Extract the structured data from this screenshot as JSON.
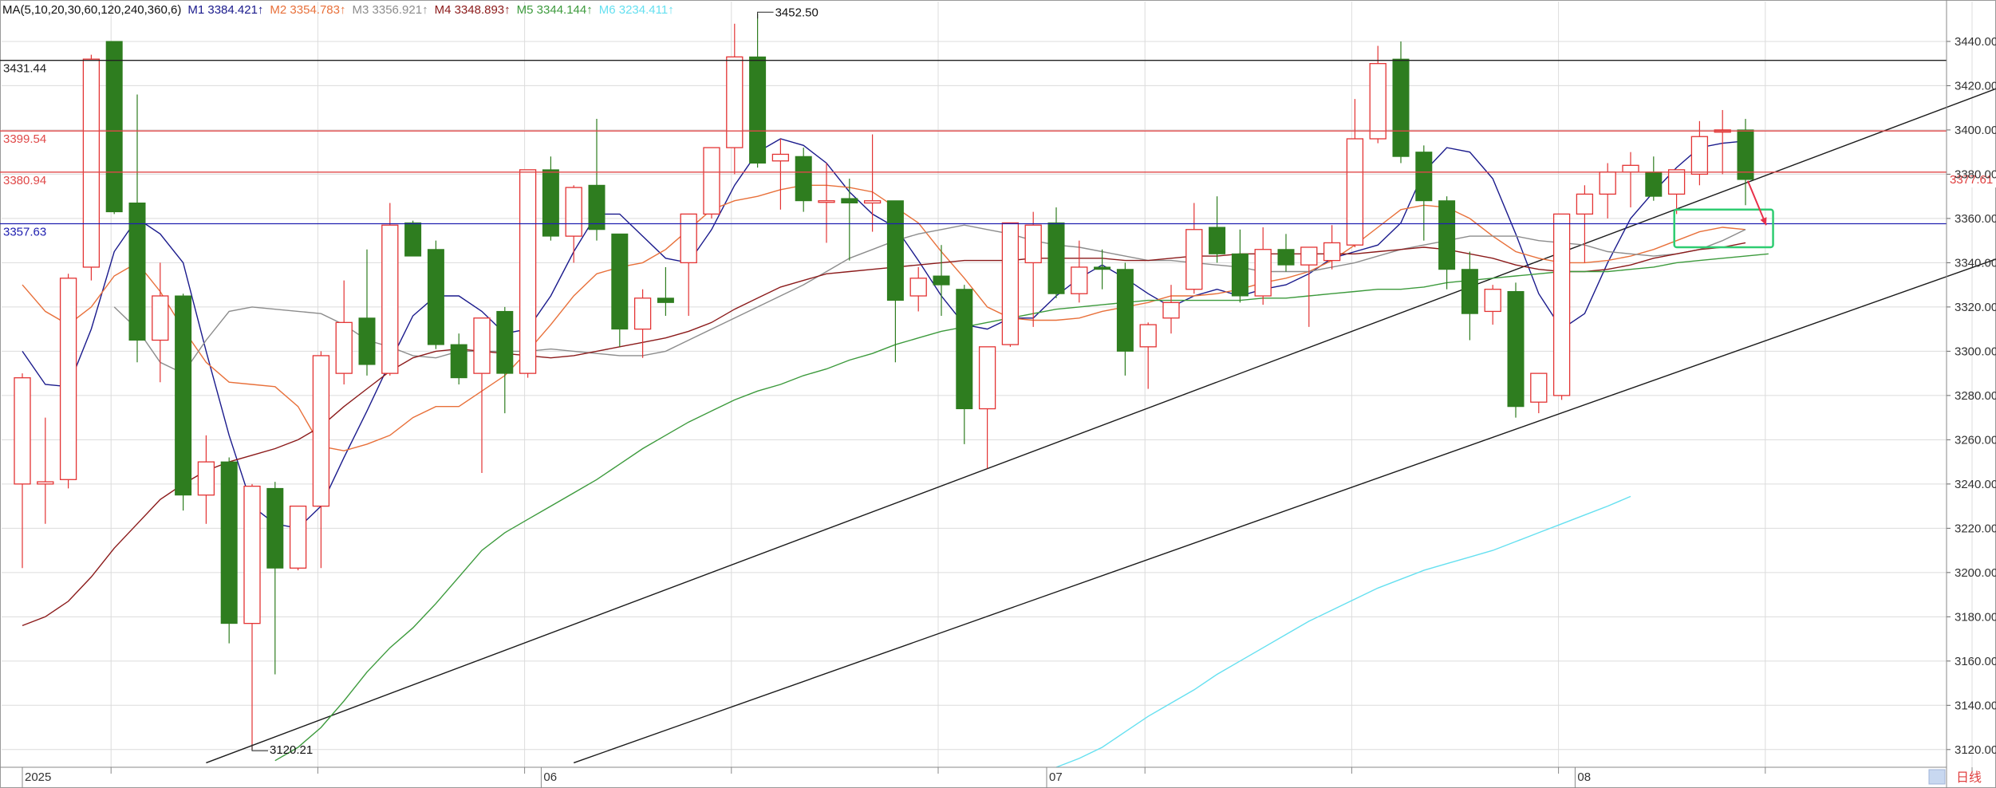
{
  "chart_data": {
    "type": "candlestick",
    "ylim": [
      3112,
      3458
    ],
    "y_ticks": [
      3120,
      3140,
      3160,
      3180,
      3200,
      3220,
      3240,
      3260,
      3280,
      3300,
      3320,
      3340,
      3360,
      3380,
      3400,
      3420,
      3440
    ],
    "x_ticks": [
      {
        "index": 0,
        "label": "2025"
      },
      {
        "index": 23,
        "label": "06"
      },
      {
        "index": 45,
        "label": "07"
      },
      {
        "index": 68,
        "label": "08"
      }
    ],
    "period_label": "日线",
    "legend": {
      "prefix": "MA(5,10,20,30,60,120,240,360,6)",
      "items": [
        {
          "key": "M1",
          "text": "M1 3384.421↑",
          "color": "#1a1a8c"
        },
        {
          "key": "M2",
          "text": "M2 3354.783↑",
          "color": "#e8703a"
        },
        {
          "key": "M3",
          "text": "M3 3356.921↑",
          "color": "#8c8c8c"
        },
        {
          "key": "M4",
          "text": "M4 3348.893↑",
          "color": "#8b1a1a"
        },
        {
          "key": "M5",
          "text": "M5 3344.144↑",
          "color": "#3c9a3c"
        },
        {
          "key": "M6",
          "text": "M6 3234.411↑",
          "color": "#66e0f0"
        }
      ]
    },
    "candles": [
      {
        "o": 3240,
        "h": 3290,
        "l": 3202,
        "c": 3288
      },
      {
        "o": 3240,
        "h": 3270,
        "l": 3222,
        "c": 3241
      },
      {
        "o": 3242,
        "h": 3335,
        "l": 3238,
        "c": 3333
      },
      {
        "o": 3338,
        "h": 3434,
        "l": 3332,
        "c": 3432
      },
      {
        "o": 3440,
        "h": 3440,
        "l": 3362,
        "c": 3363
      },
      {
        "o": 3367,
        "h": 3416,
        "l": 3295,
        "c": 3305
      },
      {
        "o": 3305,
        "h": 3340,
        "l": 3286,
        "c": 3325
      },
      {
        "o": 3325,
        "h": 3326,
        "l": 3228,
        "c": 3235
      },
      {
        "o": 3235,
        "h": 3262,
        "l": 3222,
        "c": 3250
      },
      {
        "o": 3250,
        "h": 3252,
        "l": 3168,
        "c": 3177
      },
      {
        "o": 3177,
        "h": 3240,
        "l": 3120,
        "c": 3239
      },
      {
        "o": 3238,
        "h": 3241,
        "l": 3154,
        "c": 3202
      },
      {
        "o": 3202,
        "h": 3230,
        "l": 3201,
        "c": 3230
      },
      {
        "o": 3230,
        "h": 3300,
        "l": 3202,
        "c": 3298
      },
      {
        "o": 3290,
        "h": 3332,
        "l": 3285,
        "c": 3313
      },
      {
        "o": 3315,
        "h": 3346,
        "l": 3289,
        "c": 3294
      },
      {
        "o": 3290,
        "h": 3367,
        "l": 3289,
        "c": 3357
      },
      {
        "o": 3358,
        "h": 3359,
        "l": 3343,
        "c": 3343
      },
      {
        "o": 3346,
        "h": 3350,
        "l": 3301,
        "c": 3303
      },
      {
        "o": 3303,
        "h": 3308,
        "l": 3285,
        "c": 3288
      },
      {
        "o": 3290,
        "h": 3315,
        "l": 3245,
        "c": 3315
      },
      {
        "o": 3318,
        "h": 3320,
        "l": 3272,
        "c": 3290
      },
      {
        "o": 3290,
        "h": 3382,
        "l": 3288,
        "c": 3382
      },
      {
        "o": 3382,
        "h": 3388,
        "l": 3350,
        "c": 3352
      },
      {
        "o": 3352,
        "h": 3375,
        "l": 3340,
        "c": 3374
      },
      {
        "o": 3375,
        "h": 3405,
        "l": 3350,
        "c": 3355
      },
      {
        "o": 3353,
        "h": 3353,
        "l": 3302,
        "c": 3310
      },
      {
        "o": 3310,
        "h": 3328,
        "l": 3297,
        "c": 3324
      },
      {
        "o": 3324,
        "h": 3338,
        "l": 3316,
        "c": 3322
      },
      {
        "o": 3340,
        "h": 3362,
        "l": 3316,
        "c": 3362
      },
      {
        "o": 3362,
        "h": 3390,
        "l": 3360,
        "c": 3392
      },
      {
        "o": 3392,
        "h": 3448,
        "l": 3380,
        "c": 3433
      },
      {
        "o": 3433,
        "h": 3452.5,
        "l": 3383,
        "c": 3385
      },
      {
        "o": 3386,
        "h": 3396,
        "l": 3364,
        "c": 3389
      },
      {
        "o": 3388,
        "h": 3392,
        "l": 3363,
        "c": 3368
      },
      {
        "o": 3368,
        "h": 3385,
        "l": 3349,
        "c": 3368
      },
      {
        "o": 3369,
        "h": 3378,
        "l": 3341,
        "c": 3367
      },
      {
        "o": 3367,
        "h": 3398,
        "l": 3354,
        "c": 3368
      },
      {
        "o": 3368,
        "h": 3368,
        "l": 3295,
        "c": 3323
      },
      {
        "o": 3325,
        "h": 3338,
        "l": 3318,
        "c": 3333
      },
      {
        "o": 3334,
        "h": 3348,
        "l": 3316,
        "c": 3330
      },
      {
        "o": 3328,
        "h": 3330,
        "l": 3258,
        "c": 3274
      },
      {
        "o": 3274,
        "h": 3302,
        "l": 3247,
        "c": 3302
      },
      {
        "o": 3303,
        "h": 3358,
        "l": 3302,
        "c": 3358
      },
      {
        "o": 3340,
        "h": 3363,
        "l": 3311,
        "c": 3357
      },
      {
        "o": 3358,
        "h": 3365,
        "l": 3324,
        "c": 3326
      },
      {
        "o": 3326,
        "h": 3350,
        "l": 3322,
        "c": 3338
      },
      {
        "o": 3338,
        "h": 3346,
        "l": 3328,
        "c": 3337
      },
      {
        "o": 3337,
        "h": 3340,
        "l": 3289,
        "c": 3300
      },
      {
        "o": 3302,
        "h": 3313,
        "l": 3283,
        "c": 3312
      },
      {
        "o": 3315,
        "h": 3330,
        "l": 3308,
        "c": 3322
      },
      {
        "o": 3328,
        "h": 3367,
        "l": 3326,
        "c": 3355
      },
      {
        "o": 3356,
        "h": 3370,
        "l": 3340,
        "c": 3344
      },
      {
        "o": 3344,
        "h": 3355,
        "l": 3322,
        "c": 3325
      },
      {
        "o": 3325,
        "h": 3356,
        "l": 3321,
        "c": 3346
      },
      {
        "o": 3346,
        "h": 3353,
        "l": 3336,
        "c": 3339
      },
      {
        "o": 3339,
        "h": 3346,
        "l": 3311,
        "c": 3347
      },
      {
        "o": 3341,
        "h": 3357,
        "l": 3337,
        "c": 3349
      },
      {
        "o": 3348,
        "h": 3414,
        "l": 3347,
        "c": 3396
      },
      {
        "o": 3396,
        "h": 3438,
        "l": 3394,
        "c": 3430
      },
      {
        "o": 3432,
        "h": 3440,
        "l": 3385,
        "c": 3388
      },
      {
        "o": 3390,
        "h": 3393,
        "l": 3350,
        "c": 3368
      },
      {
        "o": 3368,
        "h": 3370,
        "l": 3328,
        "c": 3337
      },
      {
        "o": 3337,
        "h": 3345,
        "l": 3305,
        "c": 3317
      },
      {
        "o": 3318,
        "h": 3330,
        "l": 3312,
        "c": 3328
      },
      {
        "o": 3327,
        "h": 3331,
        "l": 3270,
        "c": 3275
      },
      {
        "o": 3277,
        "h": 3290,
        "l": 3272,
        "c": 3290
      },
      {
        "o": 3280,
        "h": 3362,
        "l": 3278,
        "c": 3362
      },
      {
        "o": 3362,
        "h": 3375,
        "l": 3340,
        "c": 3371
      },
      {
        "o": 3371,
        "h": 3385,
        "l": 3360,
        "c": 3381
      },
      {
        "o": 3381,
        "h": 3390,
        "l": 3365,
        "c": 3384
      },
      {
        "o": 3381,
        "h": 3388,
        "l": 3368,
        "c": 3370
      },
      {
        "o": 3371,
        "h": 3380,
        "l": 3362,
        "c": 3382
      },
      {
        "o": 3380,
        "h": 3404,
        "l": 3375,
        "c": 3397
      },
      {
        "o": 3399,
        "h": 3409,
        "l": 3380,
        "c": 3400
      },
      {
        "o": 3400,
        "h": 3405,
        "l": 3366,
        "c": 3377.61
      }
    ],
    "moving_averages": [
      {
        "key": "M1",
        "color": "#1a1a8c",
        "start": 0,
        "values": [
          3300,
          3285,
          3284,
          3310,
          3345,
          3360,
          3353,
          3340,
          3300,
          3262,
          3230,
          3222,
          3220,
          3230,
          3252,
          3273,
          3295,
          3316,
          3325,
          3325,
          3318,
          3308,
          3310,
          3325,
          3345,
          3362,
          3362,
          3352,
          3342,
          3340,
          3355,
          3375,
          3390,
          3396,
          3393,
          3385,
          3372,
          3362,
          3356,
          3341,
          3325,
          3312,
          3310,
          3315,
          3315,
          3325,
          3333,
          3339,
          3333,
          3326,
          3320,
          3325,
          3328,
          3325,
          3328,
          3330,
          3335,
          3342,
          3345,
          3348,
          3358,
          3381,
          3392,
          3390,
          3378,
          3353,
          3326,
          3310,
          3317,
          3340,
          3360,
          3372,
          3383,
          3392,
          3394,
          3395
        ]
      },
      {
        "key": "M2",
        "color": "#e8703a",
        "start": 0,
        "values": [
          3330,
          3318,
          3312,
          3320,
          3334,
          3340,
          3327,
          3310,
          3295,
          3286,
          3285,
          3284,
          3275,
          3257,
          3255,
          3258,
          3262,
          3270,
          3275,
          3275,
          3282,
          3289,
          3300,
          3312,
          3325,
          3335,
          3338,
          3340,
          3346,
          3355,
          3364,
          3368,
          3370,
          3373,
          3375,
          3375,
          3374,
          3372,
          3365,
          3358,
          3345,
          3333,
          3320,
          3315,
          3314,
          3314,
          3315,
          3318,
          3320,
          3322,
          3325,
          3325,
          3326,
          3328,
          3331,
          3333,
          3336,
          3341,
          3348,
          3356,
          3364,
          3366,
          3365,
          3360,
          3352,
          3345,
          3342,
          3340,
          3340,
          3341,
          3343,
          3346,
          3350,
          3354,
          3356,
          3355
        ]
      },
      {
        "key": "M3",
        "color": "#8c8c8c",
        "start": 4,
        "values": [
          3320,
          3310,
          3295,
          3290,
          3305,
          3318,
          3320,
          3319,
          3318,
          3317,
          3312,
          3305,
          3302,
          3298,
          3297,
          3300,
          3300,
          3300,
          3300,
          3301,
          3300,
          3299,
          3298,
          3298,
          3300,
          3305,
          3310,
          3315,
          3320,
          3325,
          3330,
          3336,
          3342,
          3346,
          3350,
          3353,
          3355,
          3357,
          3355,
          3353,
          3350,
          3348,
          3347,
          3345,
          3343,
          3341,
          3341,
          3340,
          3339,
          3338,
          3336,
          3336,
          3336,
          3338,
          3340,
          3343,
          3346,
          3348,
          3350,
          3352,
          3352,
          3352,
          3350,
          3349,
          3348,
          3345,
          3344,
          3343,
          3344,
          3346,
          3350,
          3355
        ]
      },
      {
        "key": "M4",
        "color": "#8b1a1a",
        "start": 0,
        "values": [
          3176,
          3180,
          3187,
          3198,
          3211,
          3222,
          3233,
          3240,
          3246,
          3250,
          3253,
          3256,
          3260,
          3266,
          3275,
          3283,
          3291,
          3297,
          3300,
          3301,
          3300,
          3299,
          3298,
          3297,
          3298,
          3300,
          3302,
          3304,
          3306,
          3309,
          3313,
          3319,
          3324,
          3329,
          3332,
          3335,
          3336,
          3337,
          3338,
          3339,
          3340,
          3341,
          3341,
          3341,
          3342,
          3342,
          3342,
          3342,
          3341,
          3341,
          3342,
          3343,
          3343,
          3344,
          3344,
          3344,
          3344,
          3344,
          3344,
          3345,
          3346,
          3347,
          3346,
          3344,
          3342,
          3339,
          3337,
          3336,
          3336,
          3337,
          3339,
          3342,
          3344,
          3346,
          3347,
          3349
        ]
      },
      {
        "key": "M5",
        "color": "#3c9a3c",
        "start": 11,
        "values": [
          3115,
          3121,
          3130,
          3142,
          3155,
          3166,
          3175,
          3186,
          3198,
          3210,
          3218,
          3224,
          3230,
          3236,
          3242,
          3249,
          3256,
          3262,
          3268,
          3273,
          3278,
          3282,
          3285,
          3289,
          3292,
          3296,
          3299,
          3303,
          3306,
          3309,
          3311,
          3313,
          3315,
          3317,
          3319,
          3320,
          3321,
          3322,
          3323,
          3323,
          3323,
          3323,
          3323,
          3324,
          3324,
          3325,
          3326,
          3327,
          3328,
          3328,
          3329,
          3331,
          3332,
          3333,
          3334,
          3335,
          3336,
          3336,
          3336,
          3337,
          3338,
          3340,
          3341,
          3342,
          3343,
          3344
        ]
      },
      {
        "key": "M6",
        "color": "#66e0f0",
        "start": 45,
        "values": [
          3112,
          3116,
          3121,
          3128,
          3135,
          3141,
          3147,
          3154,
          3160,
          3166,
          3172,
          3178,
          3183,
          3188,
          3193,
          3197,
          3201,
          3204,
          3207,
          3210,
          3214,
          3218,
          3222,
          3226,
          3230,
          3234.4
        ]
      }
    ],
    "trendlines": [
      {
        "x1": 8,
        "y1": 3114,
        "x2": 86,
        "y2": 3419,
        "color": "#1a1a1a"
      },
      {
        "x1": 24,
        "y1": 3114,
        "x2": 86,
        "y2": 3342,
        "color": "#1a1a1a"
      }
    ],
    "horizontal_lines": [
      {
        "value": 3431.44,
        "label": "3431.44",
        "color": "#222222"
      },
      {
        "value": 3399.54,
        "label": "3399.54",
        "color": "#e04848"
      },
      {
        "value": 3380.94,
        "label": "3380.94",
        "color": "#e04848"
      },
      {
        "value": 3357.63,
        "label": "3357.63",
        "color": "#2020b0"
      }
    ],
    "annotations": [
      {
        "type": "high",
        "index": 32,
        "value": 3452.5,
        "label": "3452.50"
      },
      {
        "type": "low",
        "index": 10,
        "value": 3120.21,
        "label": "3120.21"
      }
    ],
    "last_price": {
      "value": 3377.61,
      "label": "3377.61"
    },
    "target_box": {
      "x1": 71.9,
      "x2": 76.2,
      "y1": 3364,
      "y2": 3347,
      "color": "#2ecc71"
    },
    "arrow": {
      "from_index": 75.1,
      "from_value": 3377,
      "to_index": 75.9,
      "to_value": 3357,
      "color": "#e8304a"
    },
    "colors": {
      "up": "#e33333",
      "down": "#2e7d1f",
      "grid": "#dcdcdc",
      "axis_text": "#333333"
    }
  }
}
